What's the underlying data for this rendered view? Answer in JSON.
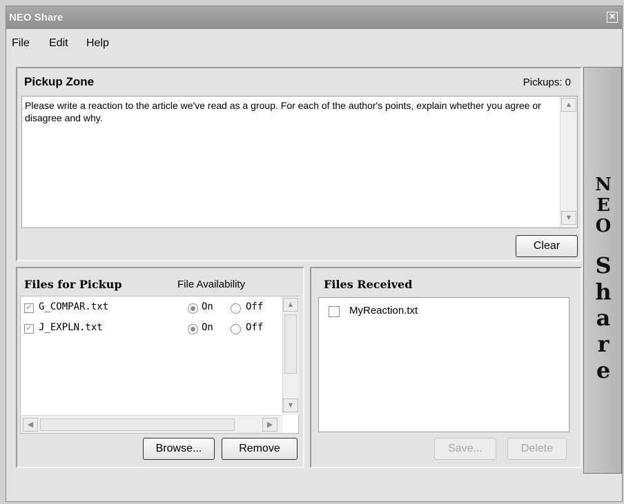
{
  "window": {
    "title": "NEO Share",
    "close_glyph": "✕"
  },
  "menu": {
    "file": "File",
    "edit": "Edit",
    "help": "Help"
  },
  "pickup_zone": {
    "heading": "Pickup Zone",
    "pickups_label": "Pickups: 0",
    "text": "Please write a reaction to the article we've read as a group. For each of the author's points, explain whether you agree or disagree and why.",
    "clear_button": "Clear"
  },
  "files_for_pickup": {
    "heading": "Files for Pickup",
    "availability_header": "File Availability",
    "files": [
      {
        "name": "G_COMPAR.txt",
        "checked": true,
        "on_label": "On",
        "off_label": "Off",
        "availability": "On"
      },
      {
        "name": "J_EXPLN.txt",
        "checked": true,
        "on_label": "On",
        "off_label": "Off",
        "availability": "On"
      }
    ],
    "browse_button": "Browse...",
    "remove_button": "Remove"
  },
  "files_received": {
    "heading": "Files Received",
    "files": [
      {
        "name": "MyReaction.txt",
        "checked": false
      }
    ],
    "save_button": "Save...",
    "delete_button": "Delete"
  },
  "brand": {
    "word1": "NEO",
    "word2": "Share"
  },
  "icons": {
    "close": "close-icon",
    "scroll_up": "chevron-up-icon",
    "scroll_down": "chevron-down-icon",
    "scroll_left": "chevron-left-icon",
    "scroll_right": "chevron-right-icon",
    "check": "checkmark-icon"
  }
}
